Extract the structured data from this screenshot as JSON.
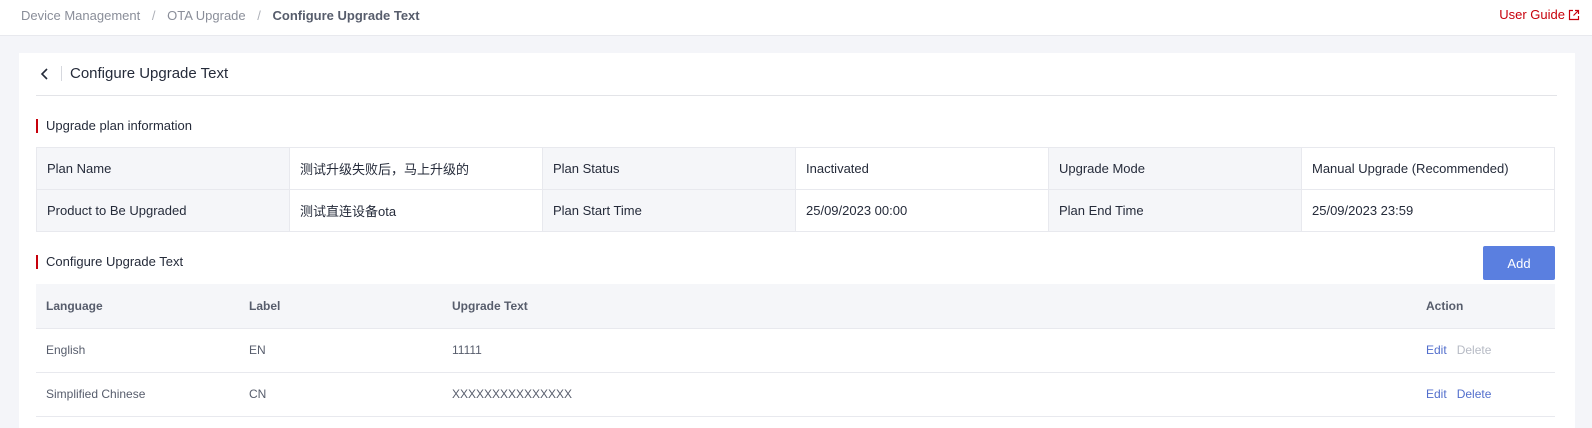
{
  "breadcrumb": {
    "items": [
      "Device Management",
      "OTA Upgrade"
    ],
    "current": "Configure Upgrade Text",
    "separator": "/"
  },
  "header": {
    "user_guide": "User Guide",
    "title": "Configure Upgrade Text"
  },
  "plan_section": {
    "title": "Upgrade plan information",
    "rows": [
      [
        "Plan Name",
        "测试升级失败后，马上升级的",
        "Plan Status",
        "Inactivated",
        "Upgrade Mode",
        "Manual Upgrade (Recommended)"
      ],
      [
        "Product to Be Upgraded",
        "测试直连设备ota",
        "Plan Start Time",
        "25/09/2023 00:00",
        "Plan End Time",
        "25/09/2023 23:59"
      ]
    ]
  },
  "text_section": {
    "title": "Configure Upgrade Text",
    "add_label": "Add",
    "columns": [
      "Language",
      "Label",
      "Upgrade Text",
      "Action"
    ],
    "rows": [
      {
        "language": "English",
        "label": "EN",
        "text": "11111",
        "edit": "Edit",
        "delete": "Delete",
        "delete_disabled": true
      },
      {
        "language": "Simplified Chinese",
        "label": "CN",
        "text": "XXXXXXXXXXXXXXX",
        "edit": "Edit",
        "delete": "Delete",
        "delete_disabled": false
      }
    ]
  },
  "colors": {
    "brand_red": "#c7000b",
    "primary_button": "#5a7fe0",
    "link_blue": "#526ecc"
  },
  "icons": {
    "back": "chevron-left-icon",
    "external": "external-link-icon"
  }
}
